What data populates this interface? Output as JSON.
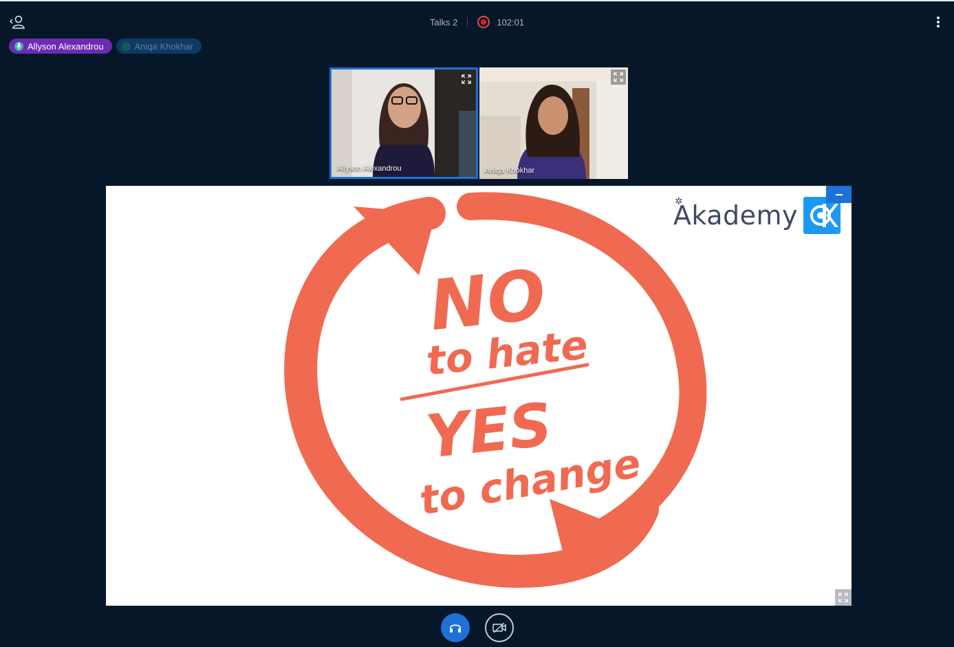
{
  "session": {
    "room_name": "Talks 2",
    "recording_time": "102:01"
  },
  "talkers": [
    {
      "name": "Allyson Alexandrou",
      "state": "talking"
    },
    {
      "name": "Aniqa Khokhar",
      "state": "muted"
    }
  ],
  "webcams": [
    {
      "name": "Allyson Alexandrou",
      "focused": true
    },
    {
      "name": "Aniqa Khokhar",
      "focused": false
    }
  ],
  "slide": {
    "brand": "Akademy",
    "line_no": "NO",
    "line_to_hate": "to hate",
    "line_yes": "YES",
    "line_to_change": "to change"
  },
  "colors": {
    "background": "#06172a",
    "accent_blue": "#1d71d8",
    "talking_purple": "#6c2bb3",
    "slide_coral": "#f06a52",
    "kde_blue": "#1d99f3",
    "record_red": "#e81c1c"
  },
  "icons": {
    "user_list": "user-list-icon",
    "record": "record-icon",
    "options": "more-vertical-icon",
    "mic": "mic-icon",
    "expand": "expand-icon",
    "audio": "headphones-icon",
    "video": "video-off-icon"
  }
}
